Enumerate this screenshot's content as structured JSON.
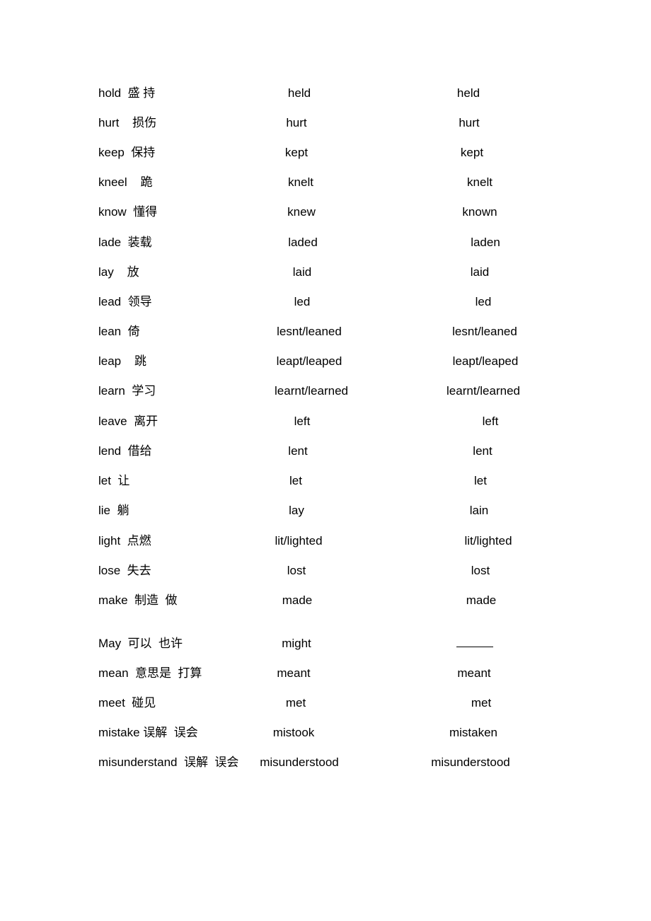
{
  "rows": [
    {
      "base": "hold  盛 持",
      "past": "held",
      "participle": "held"
    },
    {
      "base": "hurt    损伤",
      "past": "hurt",
      "participle": "hurt"
    },
    {
      "base": "keep  保持",
      "past": "kept",
      "participle": "kept"
    },
    {
      "base": "kneel    跪",
      "past": "knelt",
      "participle": "knelt"
    },
    {
      "base": "know  懂得",
      "past": "knew",
      "participle": "known"
    },
    {
      "base": "lade  装载",
      "past": "laded",
      "participle": "laden"
    },
    {
      "base": "lay    放",
      "past": "laid",
      "participle": "laid"
    },
    {
      "base": "lead  领导",
      "past": "led",
      "participle": "led"
    },
    {
      "base": "lean  倚",
      "past": "lesnt/leaned",
      "participle": "lesnt/leaned"
    },
    {
      "base": "leap    跳",
      "past": "leapt/leaped",
      "participle": "leapt/leaped"
    },
    {
      "base": "learn  学习",
      "past": "learnt/learned",
      "participle": "learnt/learned"
    },
    {
      "base": "leave  离开",
      "past": "left",
      "participle": "left"
    },
    {
      "base": "lend  借给",
      "past": "lent",
      "participle": "lent"
    },
    {
      "base": "let  让",
      "past": "let",
      "participle": "let"
    },
    {
      "base": "lie  躺",
      "past": "lay",
      "participle": "lain"
    },
    {
      "base": "light  点燃",
      "past": "lit/lighted",
      "participle": "lit/lighted"
    },
    {
      "base": "lose  失去",
      "past": "lost",
      "participle": "lost"
    },
    {
      "base": "make  制造  做",
      "past": "made",
      "participle": "made"
    },
    {
      "base": "May  可以  也许",
      "past": "might",
      "participle": ""
    },
    {
      "base": "mean  意思是  打算",
      "past": "meant",
      "participle": "meant"
    },
    {
      "base": "meet  碰见",
      "past": "met",
      "participle": "met"
    },
    {
      "base": "mistake 误解  误会",
      "past": "mistook",
      "participle": "mistaken"
    },
    {
      "base": "misunderstand  误解  误会",
      "past": "misunderstood",
      "participle": "misunderstood"
    }
  ]
}
